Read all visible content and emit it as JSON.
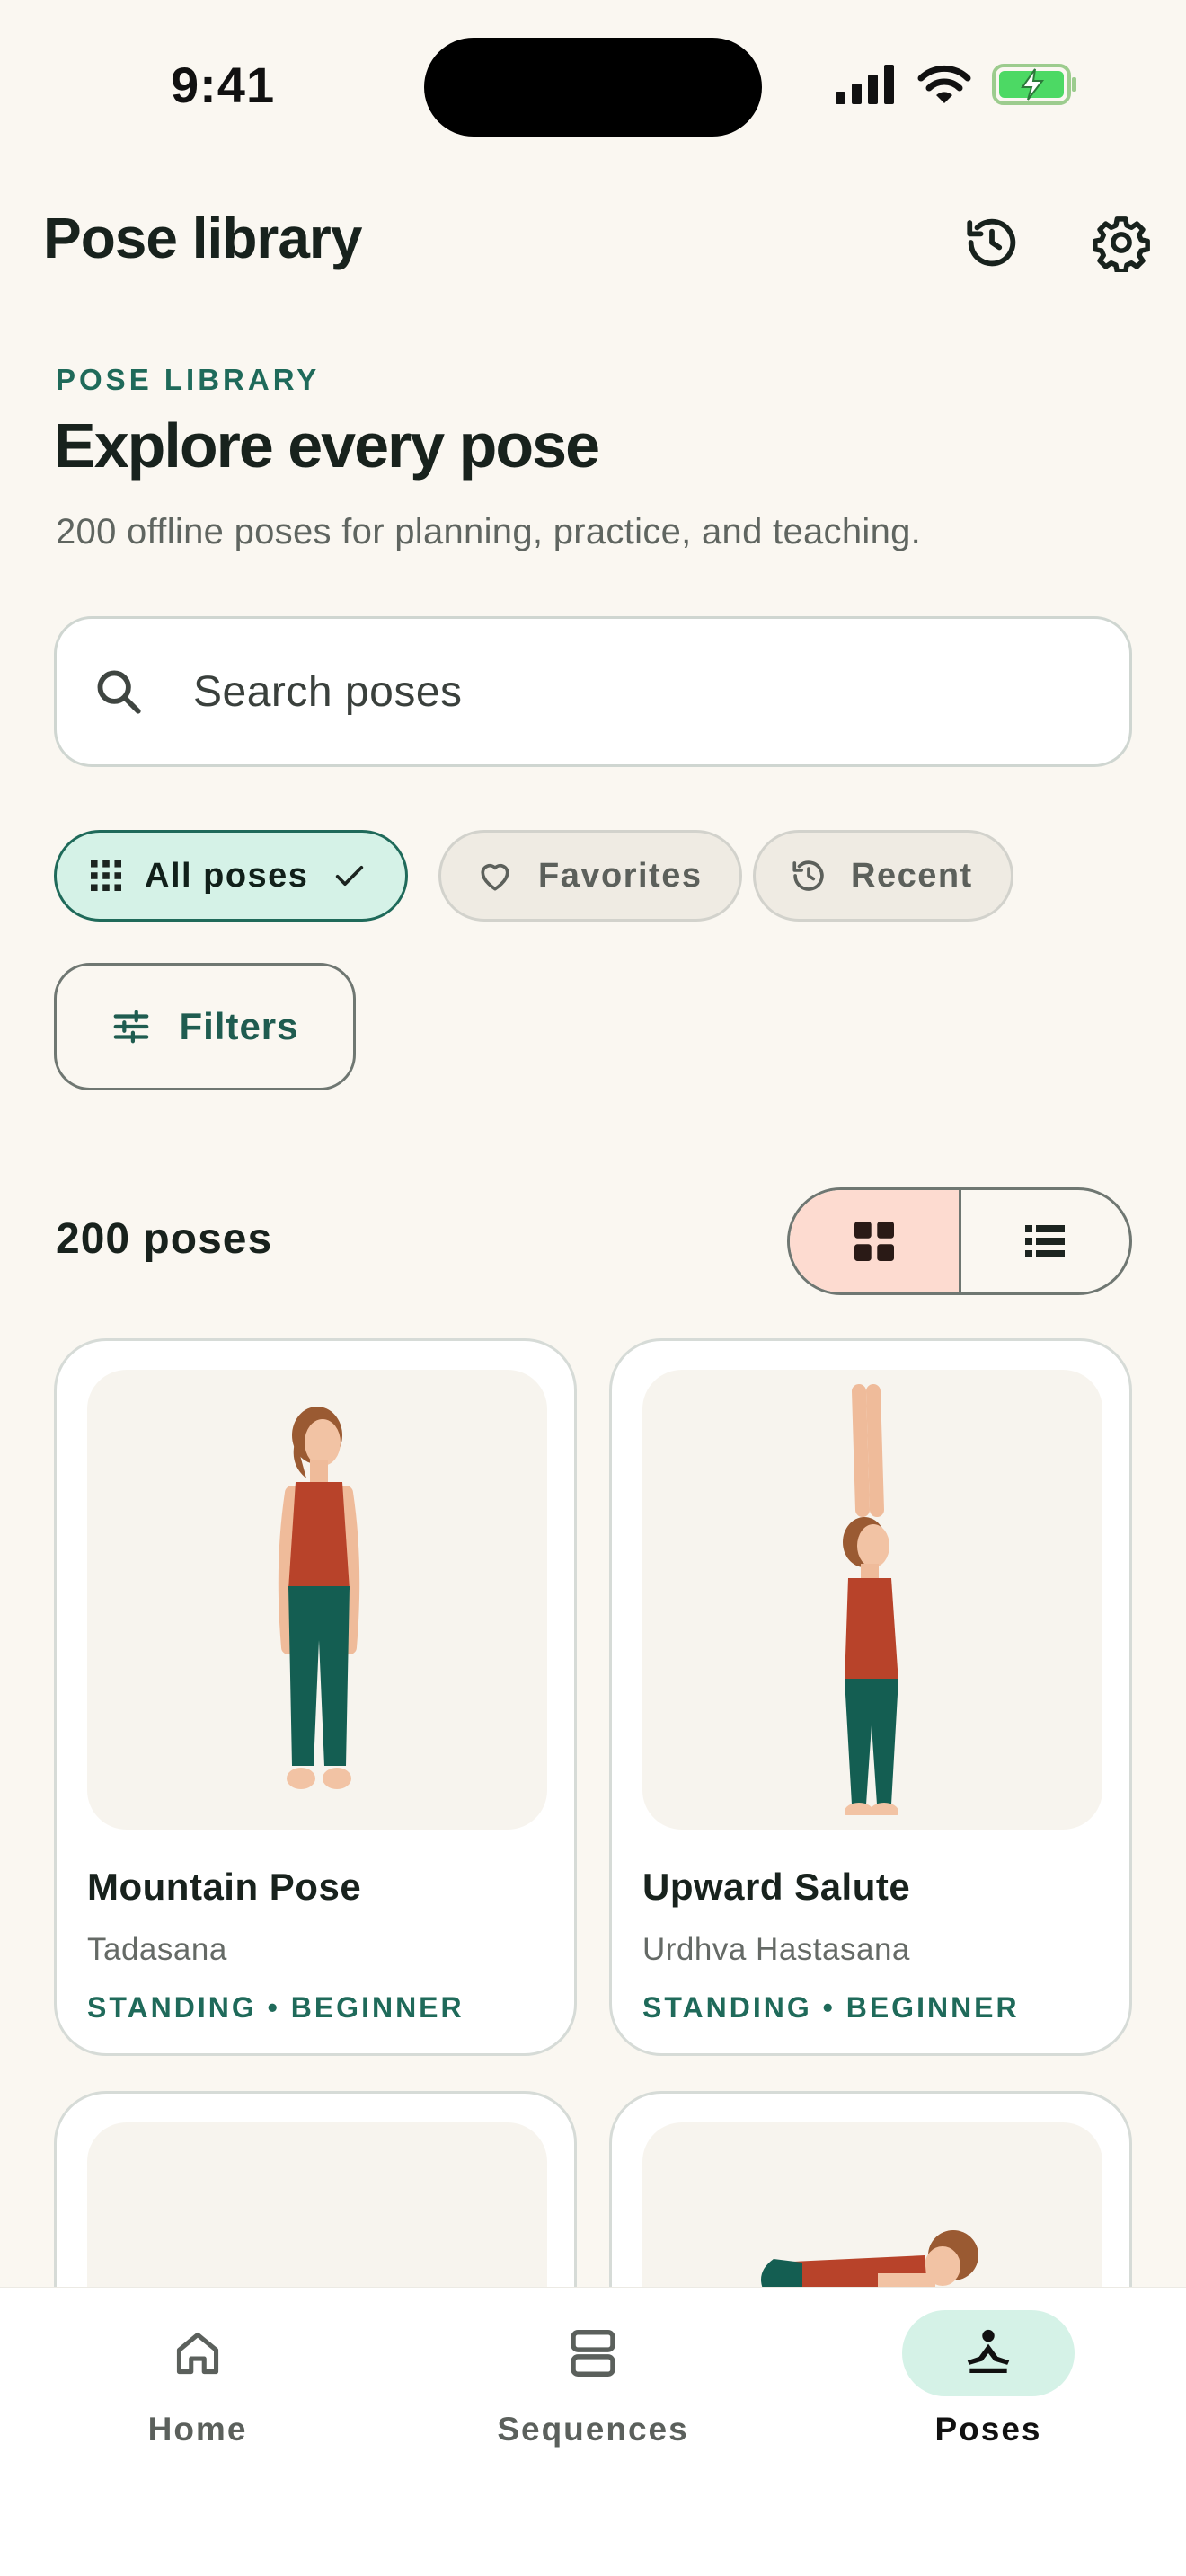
{
  "status_bar": {
    "time": "9:41"
  },
  "app_bar": {
    "title": "Pose library"
  },
  "header": {
    "eyebrow": "POSE LIBRARY",
    "headline": "Explore every pose",
    "subtitle": "200 offline poses for planning, practice, and teaching."
  },
  "search": {
    "placeholder": "Search poses"
  },
  "chips": [
    {
      "label": "All poses",
      "selected": true,
      "icon": "grid-icon"
    },
    {
      "label": "Favorites",
      "selected": false,
      "icon": "heart-icon"
    },
    {
      "label": "Recent",
      "selected": false,
      "icon": "history-icon"
    }
  ],
  "filters": {
    "label": "Filters"
  },
  "results": {
    "count_label": "200 poses",
    "view_mode": "grid"
  },
  "poses": [
    {
      "name": "Mountain Pose",
      "sanskrit": "Tadasana",
      "meta": "STANDING • BEGINNER"
    },
    {
      "name": "Upward Salute",
      "sanskrit": "Urdhva Hastasana",
      "meta": "STANDING • BEGINNER"
    }
  ],
  "nav": {
    "items": [
      {
        "label": "Home",
        "icon": "home-icon",
        "active": false
      },
      {
        "label": "Sequences",
        "icon": "sequences-icon",
        "active": false
      },
      {
        "label": "Poses",
        "icon": "pose-icon",
        "active": true
      }
    ]
  },
  "colors": {
    "accent": "#1f6a5a",
    "accent_soft": "#d5f2e7",
    "toggle_active": "#fddbd0",
    "background": "#faf7f1"
  }
}
